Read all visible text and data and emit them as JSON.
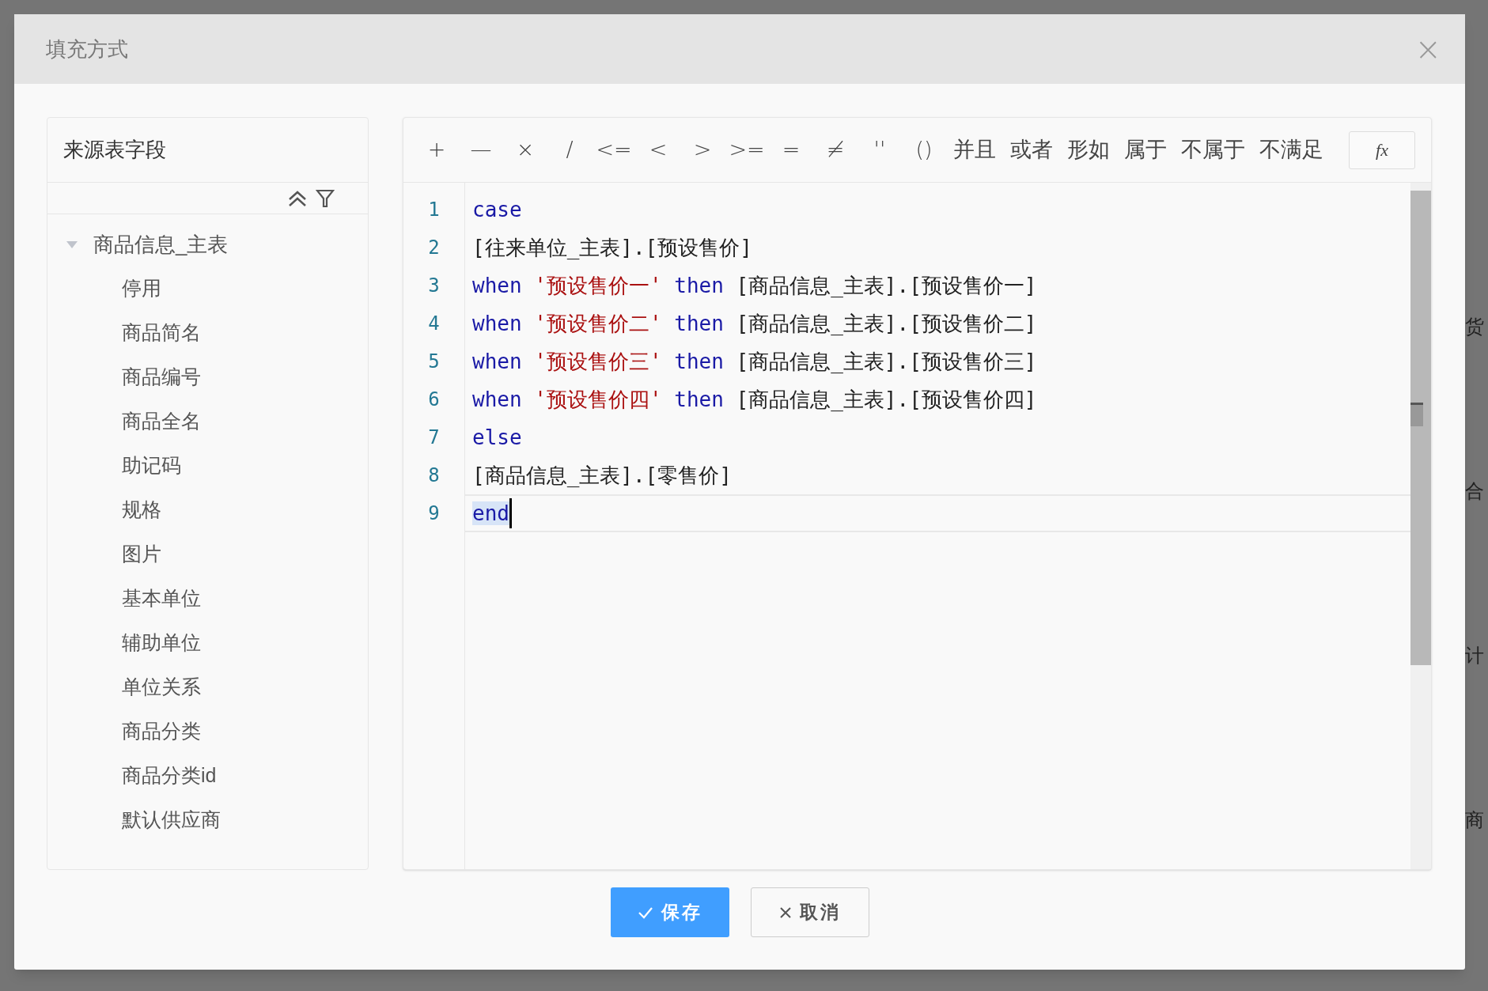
{
  "background": {
    "right_fragments": [
      "货",
      "合",
      "计",
      "商"
    ]
  },
  "dialog": {
    "title": "填充方式",
    "close": "×"
  },
  "source_panel": {
    "title": "来源表字段",
    "tree": [
      {
        "label": "商品信息_主表",
        "expanded": true,
        "children": [
          {
            "label": "停用"
          },
          {
            "label": "商品简名"
          },
          {
            "label": "商品编号"
          },
          {
            "label": "商品全名"
          },
          {
            "label": "助记码"
          },
          {
            "label": "规格"
          },
          {
            "label": "图片"
          },
          {
            "label": "基本单位"
          },
          {
            "label": "辅助单位"
          },
          {
            "label": "单位关系"
          },
          {
            "label": "商品分类"
          },
          {
            "label": "商品分类id"
          },
          {
            "label": "默认供应商"
          }
        ]
      }
    ]
  },
  "operators": [
    "+",
    "—",
    "×",
    "/",
    "<=",
    "<",
    ">",
    ">=",
    "=",
    "≠",
    "''",
    "()",
    "并且",
    "或者",
    "形如",
    "属于",
    "不属于",
    "不满足"
  ],
  "function_button": "fx",
  "code_lines": [
    {
      "number": "1",
      "current": false,
      "tokens": [
        {
          "kind": "keyword",
          "text": "case"
        }
      ]
    },
    {
      "number": "2",
      "current": false,
      "tokens": [
        {
          "kind": "text",
          "text": "[往来单位_主表].[预设售价]"
        }
      ]
    },
    {
      "number": "3",
      "current": false,
      "tokens": [
        {
          "kind": "keyword",
          "text": "when "
        },
        {
          "kind": "string",
          "text": "'预设售价一'"
        },
        {
          "kind": "keyword",
          "text": " then "
        },
        {
          "kind": "text",
          "text": "[商品信息_主表].[预设售价一]"
        }
      ]
    },
    {
      "number": "4",
      "current": false,
      "tokens": [
        {
          "kind": "keyword",
          "text": "when "
        },
        {
          "kind": "string",
          "text": "'预设售价二'"
        },
        {
          "kind": "keyword",
          "text": " then "
        },
        {
          "kind": "text",
          "text": "[商品信息_主表].[预设售价二]"
        }
      ]
    },
    {
      "number": "5",
      "current": false,
      "tokens": [
        {
          "kind": "keyword",
          "text": "when "
        },
        {
          "kind": "string",
          "text": "'预设售价三'"
        },
        {
          "kind": "keyword",
          "text": " then "
        },
        {
          "kind": "text",
          "text": "[商品信息_主表].[预设售价三]"
        }
      ]
    },
    {
      "number": "6",
      "current": false,
      "tokens": [
        {
          "kind": "keyword",
          "text": "when "
        },
        {
          "kind": "string",
          "text": "'预设售价四'"
        },
        {
          "kind": "keyword",
          "text": " then "
        },
        {
          "kind": "text",
          "text": "[商品信息_主表].[预设售价四]"
        }
      ]
    },
    {
      "number": "7",
      "current": false,
      "tokens": [
        {
          "kind": "keyword",
          "text": "else"
        }
      ]
    },
    {
      "number": "8",
      "current": false,
      "tokens": [
        {
          "kind": "text",
          "text": "[商品信息_主表].[零售价]"
        }
      ]
    },
    {
      "number": "9",
      "current": true,
      "tokens": [
        {
          "kind": "keyword",
          "text": "end"
        }
      ]
    }
  ],
  "buttons": [
    {
      "kind": "primary",
      "label": "保存"
    },
    {
      "kind": "secondary",
      "label": "取消"
    }
  ]
}
